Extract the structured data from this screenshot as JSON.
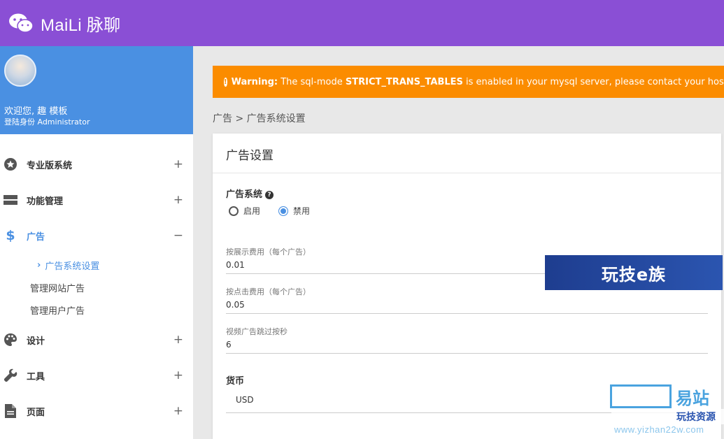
{
  "app": {
    "brand": "MaiLi 脉聊"
  },
  "profile": {
    "welcome": "欢迎您, 趣 模板",
    "role": "登陆身份 Administrator"
  },
  "sidebar": {
    "items": [
      {
        "label": "专业版系统",
        "icon": "star-icon",
        "toggle": "+"
      },
      {
        "label": "功能管理",
        "icon": "bars-icon",
        "toggle": "+"
      },
      {
        "label": "广告",
        "icon": "dollar-icon",
        "toggle": "−"
      },
      {
        "label": "设计",
        "icon": "palette-icon",
        "toggle": "+"
      },
      {
        "label": "工具",
        "icon": "wrench-icon",
        "toggle": "+"
      },
      {
        "label": "页面",
        "icon": "file-icon",
        "toggle": "+"
      }
    ],
    "ads_submenu": [
      {
        "label": "广告系统设置",
        "arrow": "›"
      },
      {
        "label": "管理网站广告"
      },
      {
        "label": "管理用户广告"
      }
    ]
  },
  "warning": {
    "prefix": "Warning:",
    "text1": " The sql-mode ",
    "mode": "STRICT_TRANS_TABLES",
    "text2": " is enabled in your mysql server, please contact your host provider to d"
  },
  "breadcrumb": "广告 > 广告系统设置",
  "card": {
    "title": "广告设置",
    "ad_system_label": "广告系统",
    "radio_enable": "启用",
    "radio_disable": "禁用",
    "selected": "禁用",
    "fields": [
      {
        "label": "按展示费用（每个广告）",
        "value": "0.01"
      },
      {
        "label": "按点击费用（每个广告）",
        "value": "0.05"
      },
      {
        "label": "视频广告跳过按秒",
        "value": "6"
      }
    ],
    "currency_label": "货币",
    "currency_value": "USD"
  },
  "overlays": {
    "badge_text": "玩技e族",
    "watermark_cn": "易站",
    "watermark_banner": "玩技资源",
    "watermark_url": "www.yizhan22w.com"
  },
  "colors": {
    "topbar": "#8a4fd5",
    "profile": "#4a90e2",
    "warning": "#fb8c00",
    "accent": "#4a90e2"
  }
}
